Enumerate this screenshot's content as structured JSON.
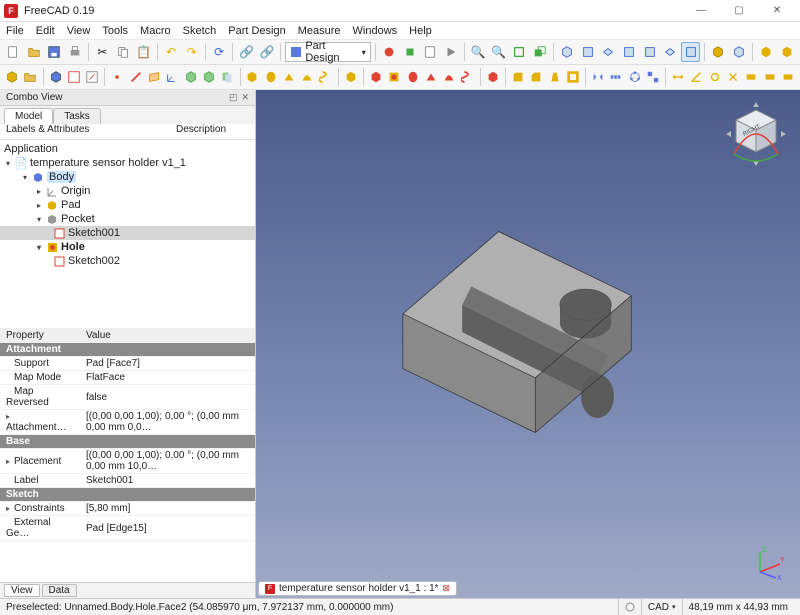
{
  "window": {
    "title": "FreeCAD 0.19",
    "logo_letter": "F"
  },
  "menu": [
    "File",
    "Edit",
    "View",
    "Tools",
    "Macro",
    "Sketch",
    "Part Design",
    "Measure",
    "Windows",
    "Help"
  ],
  "workbench": {
    "selected": "Part Design"
  },
  "combo": {
    "title": "Combo View",
    "tabs": [
      "Model",
      "Tasks"
    ],
    "active_tab": 0
  },
  "columns": {
    "labels": "Labels & Attributes",
    "desc": "Description",
    "app": "Application"
  },
  "tree": {
    "doc": "temperature sensor holder v1_1",
    "body": "Body",
    "origin": "Origin",
    "pad": "Pad",
    "pocket": "Pocket",
    "sketch001": "Sketch001",
    "hole": "Hole",
    "sketch002": "Sketch002"
  },
  "props": {
    "head_prop": "Property",
    "head_val": "Value",
    "grp_attach": "Attachment",
    "support_k": "Support",
    "support_v": "Pad [Face7]",
    "mapmode_k": "Map Mode",
    "mapmode_v": "FlatFace",
    "maprev_k": "Map Reversed",
    "maprev_v": "false",
    "attach_k": "Attachment…",
    "attach_v": "[(0,00 0,00 1,00); 0,00 °; (0,00 mm  0,00 mm  0,0…",
    "grp_base": "Base",
    "place_k": "Placement",
    "place_v": "[(0,00 0,00 1,00); 0,00 °; (0,00 mm  0,00 mm  10,0…",
    "label_k": "Label",
    "label_v": "Sketch001",
    "grp_sketch": "Sketch",
    "constr_k": "Constraints",
    "constr_v": "[5,80 mm]",
    "ext_k": "External Ge…",
    "ext_v": "Pad [Edge15]"
  },
  "bottom_tabs": [
    "View",
    "Data"
  ],
  "document_tab": "temperature sensor holder v1_1 : 1*",
  "status": {
    "preselect": "Preselected: Unnamed.Body.Hole.Face2 (54.085970 μm, 7.972137 mm, 0.000000 mm)",
    "cad": "CAD",
    "dims": "48,19 mm x 44,93 mm"
  },
  "colors": {
    "accent": "#3a66c6",
    "red": "#d43",
    "green": "#4a4",
    "blue": "#36c",
    "yellow": "#e2b100"
  }
}
